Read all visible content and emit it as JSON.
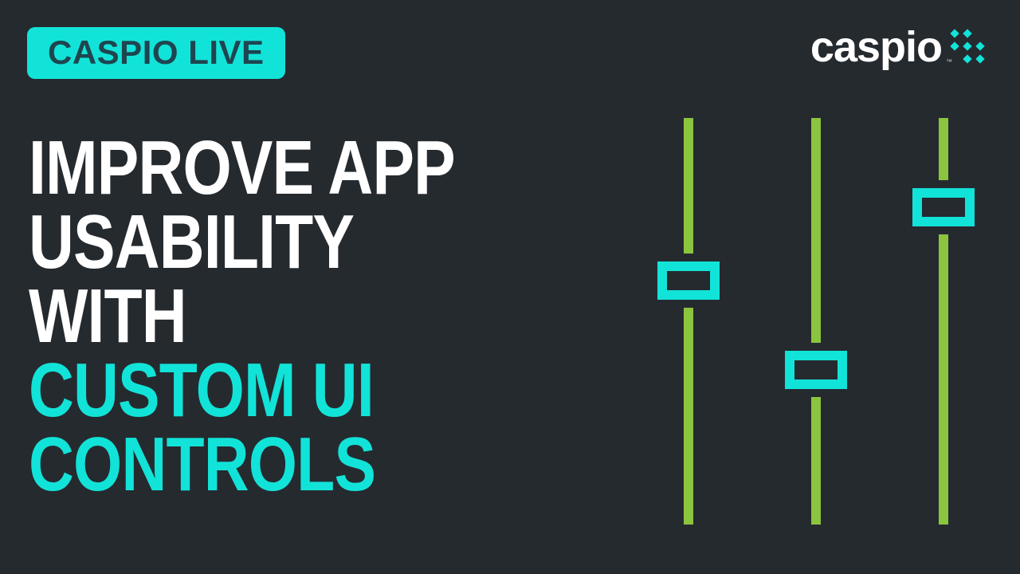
{
  "badge": {
    "label": "CASPIO LIVE"
  },
  "logo": {
    "name": "caspio",
    "trademark": "™"
  },
  "headline": {
    "line1": "IMPROVE APP",
    "line2": "USABILITY WITH",
    "line3": "CUSTOM UI",
    "line4": "CONTROLS"
  },
  "colors": {
    "accent": "#12e3d8",
    "slider_track": "#8bc43f",
    "background": "#252a2f"
  }
}
